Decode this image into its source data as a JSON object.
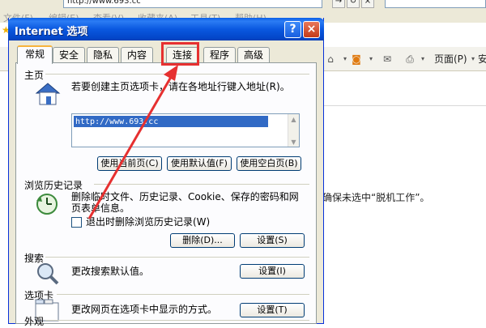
{
  "browser": {
    "address_text": "http://www.693.cc",
    "menus": [
      "文件(F)",
      "编辑(E)",
      "查看(V)",
      "收藏夹(A)",
      "工具(T)",
      "帮助(H)"
    ],
    "toolbar_page": "页面(P)",
    "toolbar_safety": "安",
    "note_text": "确保未选中“脱机工作”。"
  },
  "dialog": {
    "title": "Internet 选项",
    "help_symbol": "?",
    "close_symbol": "×",
    "tabs": [
      "常规",
      "安全",
      "隐私",
      "内容",
      "连接",
      "程序",
      "高级"
    ],
    "active_tab": "常规",
    "highlighted_tab": "连接",
    "homepage": {
      "title": "主页",
      "description": "若要创建主页选项卡，请在各地址行键入地址(R)。",
      "url": "http://www.693.cc",
      "btn_current": "使用当前页(C)",
      "btn_default": "使用默认值(F)",
      "btn_blank": "使用空白页(B)"
    },
    "history": {
      "title": "浏览历史记录",
      "description": "删除临时文件、历史记录、Cookie、保存的密码和网页表单信息。",
      "checkbox_label": "退出时删除浏览历史记录(W)",
      "checkbox_checked": false,
      "btn_delete": "删除(D)...",
      "btn_settings": "设置(S)"
    },
    "search": {
      "title": "搜索",
      "description": "更改搜索默认值。",
      "btn_settings": "设置(I)"
    },
    "tabs_section": {
      "title": "选项卡",
      "description": "更改网页在选项卡中显示的方式。",
      "btn_settings": "设置(T)"
    },
    "appearance": {
      "title": "外观"
    }
  },
  "colors": {
    "highlight": "#e63030",
    "title_bar": "#0a58e0"
  }
}
